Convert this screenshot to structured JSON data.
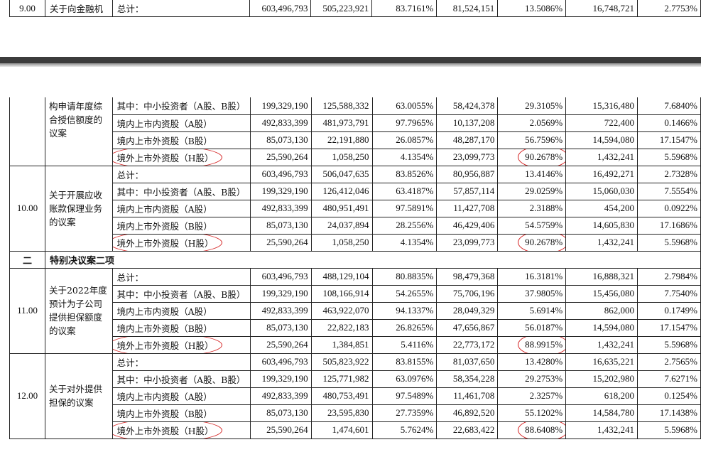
{
  "top_row": {
    "seq": "9.00",
    "name": "关于向金融机",
    "category": "总计：",
    "cols": [
      "603,496,793",
      "505,223,921",
      "83.7161%",
      "81,524,151",
      "13.5086%",
      "16,748,721",
      "2.7753%"
    ]
  },
  "colors": {
    "highlight": "#d42020",
    "separator": "#3c3c3c"
  },
  "blocks": [
    {
      "seq": "",
      "name": "构申请年度综合授信额度的议案",
      "rows": [
        {
          "category": "其中：中小投资者（A股、B股）",
          "cols": [
            "199,329,190",
            "125,588,332",
            "63.0055%",
            "58,424,378",
            "29.3105%",
            "15,316,480",
            "7.6840%"
          ]
        },
        {
          "category": "境内上市内资股（A股）",
          "cols": [
            "492,833,399",
            "481,973,791",
            "97.7965%",
            "10,137,208",
            "2.0569%",
            "722,400",
            "0.1466%"
          ]
        },
        {
          "category": "境内上市外资股（B股）",
          "cols": [
            "85,073,130",
            "22,191,880",
            "26.0857%",
            "48,287,170",
            "56.7596%",
            "14,594,080",
            "17.1547%"
          ]
        },
        {
          "category": "境外上市外资股（H股）",
          "cols": [
            "25,590,264",
            "1,058,250",
            "4.1354%",
            "23,099,773",
            "90.2678%",
            "1,432,241",
            "5.5968%"
          ]
        }
      ]
    },
    {
      "seq": "10.00",
      "name": "关于开展应收账款保理业务的议案",
      "rows": [
        {
          "category": "总计：",
          "cols": [
            "603,496,793",
            "506,047,635",
            "83.8526%",
            "80,956,887",
            "13.4146%",
            "16,492,271",
            "2.7328%"
          ]
        },
        {
          "category": "其中：中小投资者（A股、B股）",
          "cols": [
            "199,329,190",
            "126,412,046",
            "63.4187%",
            "57,857,114",
            "29.0259%",
            "15,060,030",
            "7.5554%"
          ]
        },
        {
          "category": "境内上市内资股（A股）",
          "cols": [
            "492,833,399",
            "480,951,491",
            "97.5891%",
            "11,427,708",
            "2.3188%",
            "454,200",
            "0.0922%"
          ]
        },
        {
          "category": "境内上市外资股（B股）",
          "cols": [
            "85,073,130",
            "24,037,894",
            "28.2556%",
            "46,429,406",
            "54.5759%",
            "14,605,830",
            "17.1686%"
          ]
        },
        {
          "category": "境外上市外资股（H股）",
          "cols": [
            "25,590,264",
            "1,058,250",
            "4.1354%",
            "23,099,773",
            "90.2678%",
            "1,432,241",
            "5.5968%"
          ]
        }
      ]
    },
    {
      "section_no": "二",
      "section_title": "特别决议案二项"
    },
    {
      "seq": "11.00",
      "name": "关于2022年度预计为子公司提供担保额度的议案",
      "rows": [
        {
          "category": "总计：",
          "cols": [
            "603,496,793",
            "488,129,104",
            "80.8835%",
            "98,479,368",
            "16.3181%",
            "16,888,321",
            "2.7984%"
          ]
        },
        {
          "category": "其中：中小投资者（A股、B股）",
          "cols": [
            "199,329,190",
            "108,166,914",
            "54.2655%",
            "75,706,196",
            "37.9805%",
            "15,456,080",
            "7.7540%"
          ]
        },
        {
          "category": "境内上市内资股（A股）",
          "cols": [
            "492,833,399",
            "463,922,070",
            "94.1337%",
            "28,049,329",
            "5.6914%",
            "862,000",
            "0.1749%"
          ]
        },
        {
          "category": "境内上市外资股（B股）",
          "cols": [
            "85,073,130",
            "22,822,183",
            "26.8265%",
            "47,656,867",
            "56.0187%",
            "14,594,080",
            "17.1547%"
          ]
        },
        {
          "category": "境外上市外资股（H股）",
          "cols": [
            "25,590,264",
            "1,384,851",
            "5.4116%",
            "22,773,172",
            "88.9915%",
            "1,432,241",
            "5.5968%"
          ]
        }
      ]
    },
    {
      "seq": "12.00",
      "name": "关于对外提供担保的议案",
      "rows": [
        {
          "category": "总计：",
          "cols": [
            "603,496,793",
            "505,823,922",
            "83.8155%",
            "81,037,650",
            "13.4280%",
            "16,635,221",
            "2.7565%"
          ]
        },
        {
          "category": "其中：中小投资者（A股、B股）",
          "cols": [
            "199,329,190",
            "125,771,982",
            "63.0976%",
            "58,354,228",
            "29.2753%",
            "15,202,980",
            "7.6271%"
          ]
        },
        {
          "category": "境内上市内资股（A股）",
          "cols": [
            "492,833,399",
            "480,753,491",
            "97.5489%",
            "11,461,708",
            "2.3257%",
            "618,200",
            "0.1254%"
          ]
        },
        {
          "category": "境内上市外资股（B股）",
          "cols": [
            "85,073,130",
            "23,595,830",
            "27.7359%",
            "46,892,520",
            "55.1202%",
            "14,584,780",
            "17.1438%"
          ]
        },
        {
          "category": "境外上市外资股（H股）",
          "cols": [
            "25,590,264",
            "1,474,601",
            "5.7624%",
            "22,683,422",
            "88.6408%",
            "1,432,241",
            "5.5968%"
          ]
        }
      ]
    }
  ]
}
